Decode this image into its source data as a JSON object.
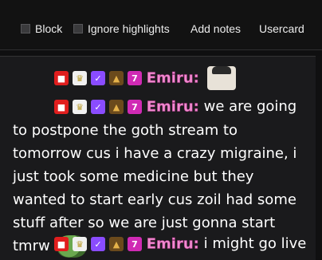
{
  "toolbar": {
    "block_label": "Block",
    "ignore_highlights_label": "Ignore highlights",
    "add_notes_label": "Add notes",
    "usercard_label": "Usercard"
  },
  "badges": [
    "live",
    "sub",
    "verified",
    "cowboy",
    "7tv"
  ],
  "messages": [
    {
      "username": "Emiru:",
      "text": "",
      "emote": "smiling-girl-emote"
    },
    {
      "username": "Emiru:",
      "text": "we are going to postpone the goth stream to tomorrow cus i have a crazy migraine, i just took some medicine but they wanted to start early cus zoil had some stuff after so we are just gonna start tmrw",
      "emote": "frog-emote"
    },
    {
      "username": "Emiru:",
      "text": "i might go live",
      "emote": ""
    }
  ],
  "colors": {
    "username": "#f08cd0",
    "background": "#1a1a1c"
  }
}
